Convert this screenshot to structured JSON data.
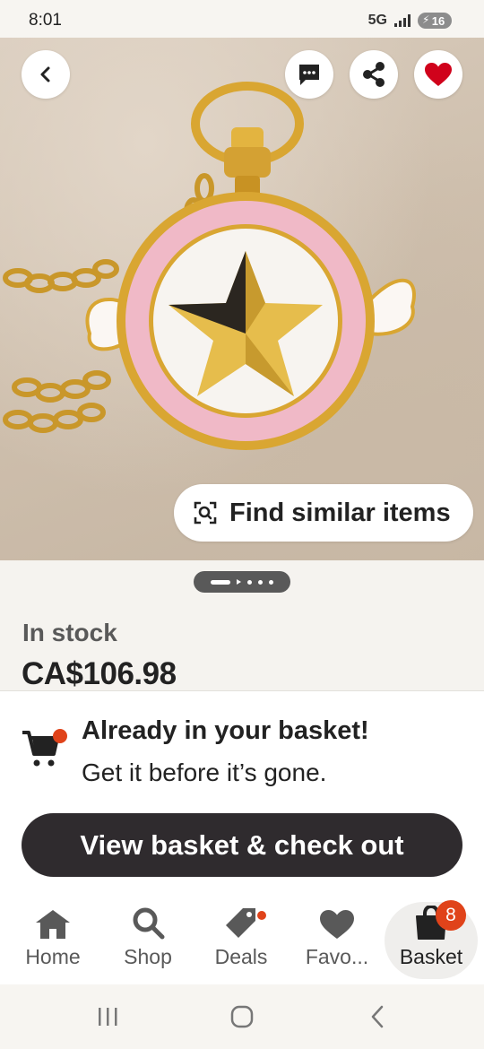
{
  "status_bar": {
    "time": "8:01",
    "network": "5G",
    "battery": "16"
  },
  "product": {
    "stock_status": "In stock",
    "price": "CA$106.98",
    "find_similar_label": "Find similar items"
  },
  "basket_sheet": {
    "title": "Already in your basket!",
    "subtitle": "Get it before it’s gone.",
    "checkout_label": "View basket & check out"
  },
  "bottom_nav": {
    "items": [
      {
        "label": "Home",
        "icon": "home-icon"
      },
      {
        "label": "Shop",
        "icon": "search-icon"
      },
      {
        "label": "Deals",
        "icon": "tag-icon"
      },
      {
        "label": "Favo...",
        "icon": "heart-icon"
      },
      {
        "label": "Basket",
        "icon": "bag-icon"
      }
    ],
    "basket_count": "8"
  },
  "colors": {
    "accent": "#e0431a",
    "favorite": "#d0021b",
    "button_dark": "#2f2b2e"
  }
}
